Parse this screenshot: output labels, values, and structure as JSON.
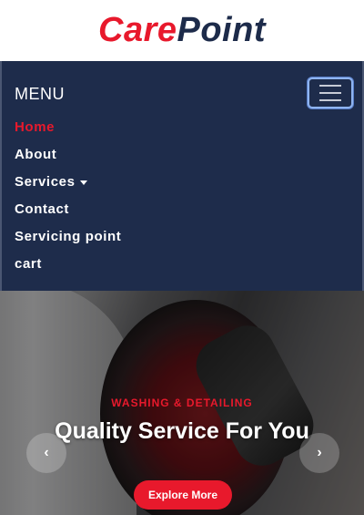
{
  "brand": {
    "logo_part1": "Care",
    "logo_part2": "Point",
    "colors": {
      "red": "#e8192c",
      "navy": "#1d2b4a"
    }
  },
  "navbar": {
    "menu_label": "MENU",
    "toggler_icon": "hamburger-icon",
    "items": [
      {
        "label": "Home",
        "active": true
      },
      {
        "label": "About"
      },
      {
        "label": "Services",
        "dropdown": true
      },
      {
        "label": "Contact"
      },
      {
        "label": "Servicing point"
      },
      {
        "label": "cart"
      }
    ]
  },
  "hero": {
    "subtitle": "WASHING & DETAILING",
    "title": "Quality Service For You",
    "prev_icon": "chevron-left-icon",
    "prev_glyph": "‹",
    "next_icon": "chevron-right-icon",
    "next_glyph": "›",
    "cta_label": "Explore More"
  }
}
